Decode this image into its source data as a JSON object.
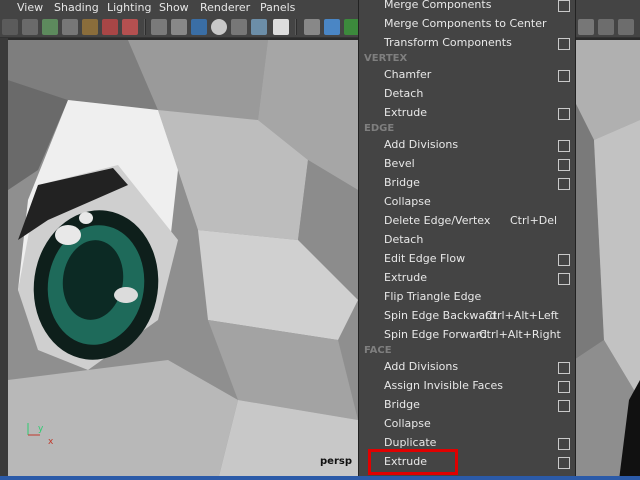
{
  "menubar": {
    "items": [
      {
        "label": "View"
      },
      {
        "label": "Shading"
      },
      {
        "label": "Lighting"
      },
      {
        "label": "Show"
      },
      {
        "label": "Renderer"
      },
      {
        "label": "Panels"
      }
    ]
  },
  "viewport": {
    "camera_label": "persp",
    "axis_x": "x",
    "axis_y": "y"
  },
  "menu": {
    "top_items": [
      {
        "label": "Merge Components",
        "option_box": true
      },
      {
        "label": "Merge Components to Center",
        "option_box": false
      },
      {
        "label": "Transform Components",
        "option_box": true
      }
    ],
    "vertex_header": "VERTEX",
    "vertex_items": [
      {
        "label": "Chamfer",
        "option_box": true
      },
      {
        "label": "Detach",
        "option_box": false
      },
      {
        "label": "Extrude",
        "option_box": true
      }
    ],
    "edge_header": "EDGE",
    "edge_items": [
      {
        "label": "Add Divisions",
        "option_box": true
      },
      {
        "label": "Bevel",
        "option_box": true
      },
      {
        "label": "Bridge",
        "option_box": true
      },
      {
        "label": "Collapse",
        "option_box": false
      },
      {
        "label": "Delete Edge/Vertex",
        "shortcut": "Ctrl+Del",
        "option_box": false
      },
      {
        "label": "Detach",
        "option_box": false
      },
      {
        "label": "Edit Edge Flow",
        "option_box": true
      },
      {
        "label": "Extrude",
        "option_box": true
      },
      {
        "label": "Flip Triangle Edge",
        "option_box": false
      },
      {
        "label": "Spin Edge Backward",
        "shortcut": "Ctrl+Alt+Left",
        "option_box": false
      },
      {
        "label": "Spin Edge Forward",
        "shortcut": "Ctrl+Alt+Right",
        "option_box": false
      }
    ],
    "face_header": "FACE",
    "face_items": [
      {
        "label": "Add Divisions",
        "option_box": true
      },
      {
        "label": "Assign Invisible Faces",
        "option_box": true
      },
      {
        "label": "Bridge",
        "option_box": true
      },
      {
        "label": "Collapse",
        "option_box": false
      },
      {
        "label": "Duplicate",
        "option_box": true
      },
      {
        "label": "Extrude",
        "option_box": true,
        "highlighted": true
      }
    ]
  },
  "colors": {
    "highlight": "#e00000",
    "menu_bg": "#444444",
    "header_text": "#7f7f7f"
  }
}
